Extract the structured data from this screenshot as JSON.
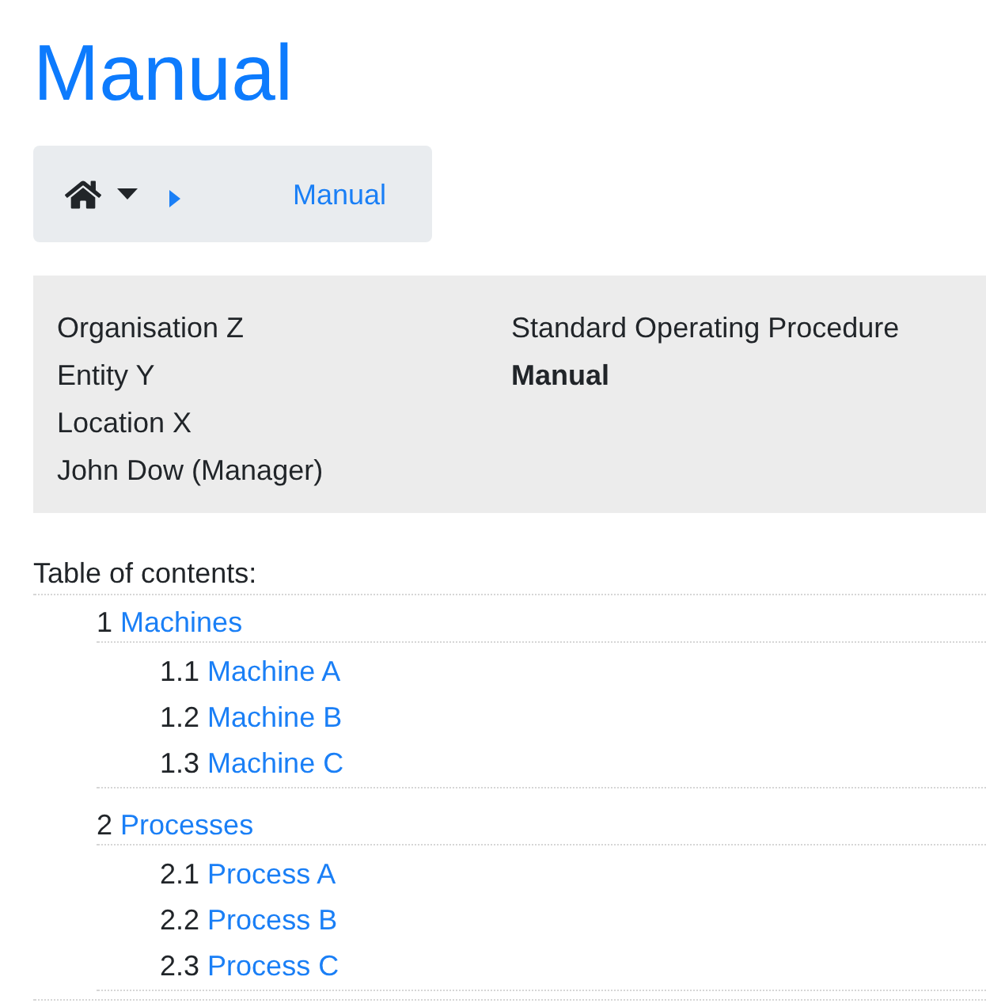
{
  "page_title": "Manual",
  "breadcrumb": {
    "link": "Manual"
  },
  "info_card": {
    "left_lines": [
      "Organisation Z",
      "Entity Y",
      "Location X",
      "John Dow (Manager)"
    ],
    "right_lines": [
      {
        "text": "Standard Operating Procedure",
        "bold": false
      },
      {
        "text": "Manual",
        "bold": true
      }
    ]
  },
  "table_of_contents": {
    "heading": "Table of contents:",
    "items": [
      {
        "number": "1",
        "label": "Machines",
        "children": [
          {
            "number": "1.1",
            "label": "Machine A"
          },
          {
            "number": "1.2",
            "label": "Machine B"
          },
          {
            "number": "1.3",
            "label": "Machine C"
          }
        ]
      },
      {
        "number": "2",
        "label": "Processes",
        "children": [
          {
            "number": "2.1",
            "label": "Process A"
          },
          {
            "number": "2.2",
            "label": "Process B"
          },
          {
            "number": "2.3",
            "label": "Process C"
          }
        ]
      }
    ]
  }
}
